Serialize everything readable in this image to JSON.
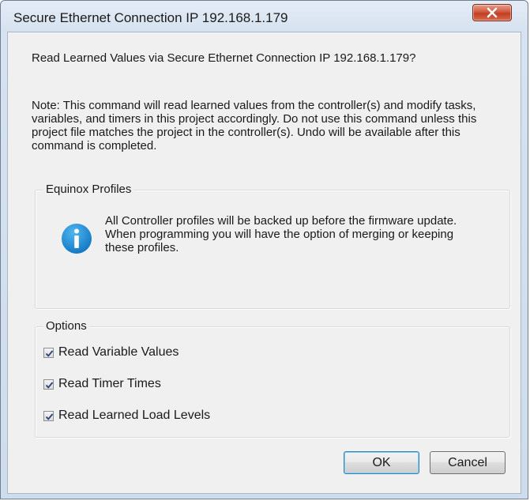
{
  "window": {
    "title": "Secure Ethernet Connection IP 192.168.1.179"
  },
  "dialog": {
    "question": "Read Learned Values via Secure Ethernet Connection IP 192.168.1.179?",
    "note": "Note:  This command will read learned values from the controller(s) and modify tasks, variables, and timers in this project accordingly.  Do not use this command unless this project file matches the project in the controller(s).  Undo will be available after this command is completed."
  },
  "profiles": {
    "label": "Equinox Profiles",
    "icon": "info-icon",
    "message": "All Controller profiles will be backed up before the firmware update. When programming you will have the option of merging or keeping these profiles."
  },
  "options": {
    "label": "Options",
    "items": [
      {
        "label": "Read Variable Values",
        "checked": true
      },
      {
        "label": "Read Timer Times",
        "checked": true
      },
      {
        "label": "Read Learned Load Levels",
        "checked": true
      }
    ]
  },
  "buttons": {
    "ok": "OK",
    "cancel": "Cancel"
  },
  "colors": {
    "info_icon": "#1d8fd6",
    "close_button": "#c74b30"
  }
}
